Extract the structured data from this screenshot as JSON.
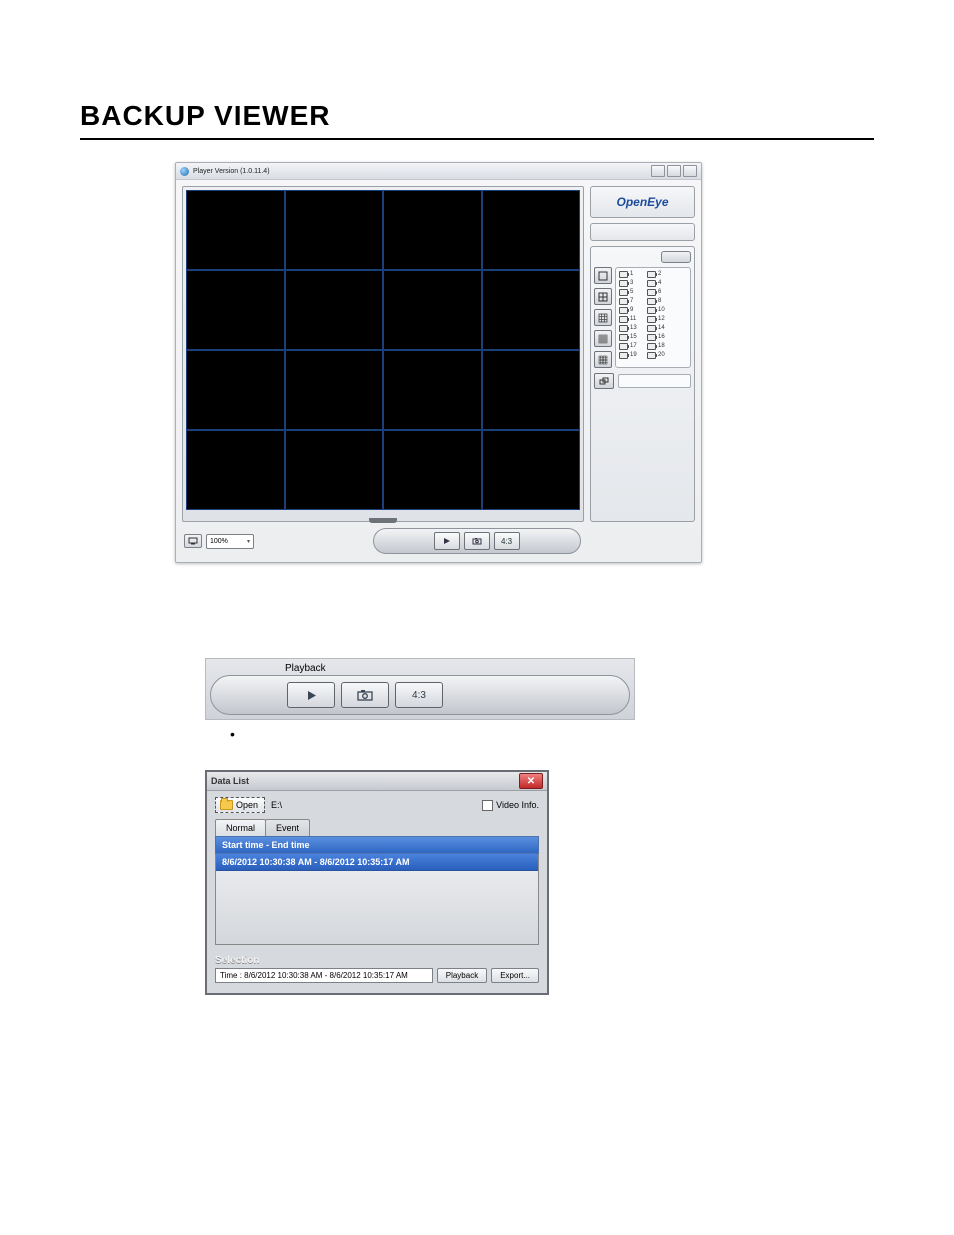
{
  "page": {
    "title": "BACKUP VIEWER"
  },
  "player": {
    "window_title": "Player Version (1.0.11.4)",
    "logo": "OpenEye",
    "cameras": [
      1,
      2,
      3,
      4,
      5,
      6,
      7,
      8,
      9,
      10,
      11,
      12,
      13,
      14,
      15,
      16,
      17,
      18,
      19,
      20
    ],
    "zoom_value": "100%",
    "ratio_label": "4:3"
  },
  "playback_bar": {
    "label": "Playback",
    "ratio_label": "4:3"
  },
  "bullet": "•",
  "datalist": {
    "title": "Data List",
    "open_label": "Open",
    "path": "E:\\",
    "video_info_label": "Video Info.",
    "tab_normal": "Normal",
    "tab_event": "Event",
    "header": "Start time  -  End time",
    "row1": "8/6/2012 10:30:38 AM  -  8/6/2012 10:35:17 AM",
    "selection_label": "Selection",
    "selection_time": "Time : 8/6/2012 10:30:38 AM  -  8/6/2012 10:35:17 AM",
    "playback_btn": "Playback",
    "export_btn": "Export..."
  }
}
